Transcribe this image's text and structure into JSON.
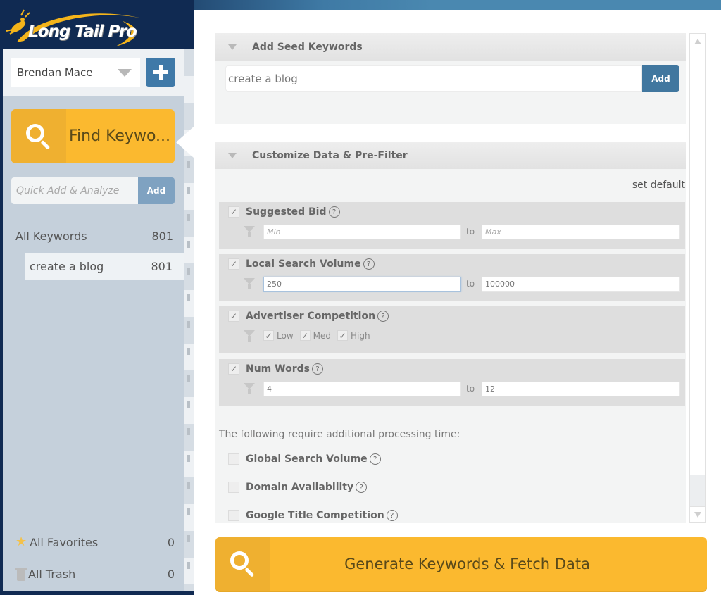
{
  "app": {
    "logo_text": "Long Tail Pro"
  },
  "sidebar": {
    "user_select": {
      "value": "Brendan Mace"
    },
    "find_keywords_label": "Find Keywo...",
    "quick_add": {
      "placeholder": "Quick Add & Analyze",
      "button_label": "Add"
    },
    "items": [
      {
        "label": "All Keywords",
        "count": "801"
      },
      {
        "label": "create a blog",
        "count": "801"
      }
    ],
    "favorites": {
      "label": "All Favorites",
      "count": "0"
    },
    "trash": {
      "label": "All Trash",
      "count": "0"
    }
  },
  "seed_section": {
    "title": "Add Seed Keywords",
    "input_value": "create a blog",
    "add_label": "Add"
  },
  "customize_section": {
    "title": "Customize Data & Pre-Filter",
    "set_default_label": "set default",
    "help_glyph": "?",
    "to_label": "to",
    "filters": {
      "suggested_bid": {
        "label": "Suggested Bid",
        "checked": true,
        "min_placeholder": "Min",
        "max_placeholder": "Max",
        "min_value": "",
        "max_value": ""
      },
      "local_search_volume": {
        "label": "Local Search Volume",
        "checked": true,
        "min_value": "250",
        "max_value": "100000"
      },
      "advertiser_competition": {
        "label": "Advertiser Competition",
        "checked": true,
        "options": [
          {
            "label": "Low",
            "checked": true
          },
          {
            "label": "Med",
            "checked": true
          },
          {
            "label": "High",
            "checked": true
          }
        ]
      },
      "num_words": {
        "label": "Num Words",
        "checked": true,
        "min_value": "4",
        "max_value": "12"
      }
    },
    "processing_note": "The following require additional processing time:",
    "extra_options": [
      {
        "label": "Global Search Volume",
        "checked": false
      },
      {
        "label": "Domain Availability",
        "checked": false
      },
      {
        "label": "Google Title Competition",
        "checked": false
      }
    ]
  },
  "generate_button": {
    "label": "Generate Keywords & Fetch Data"
  },
  "colors": {
    "accent_yellow": "#fbb92f",
    "accent_blue": "#41779f",
    "sidebar_bg": "#c5d0db",
    "frame_dark": "#102a52"
  }
}
